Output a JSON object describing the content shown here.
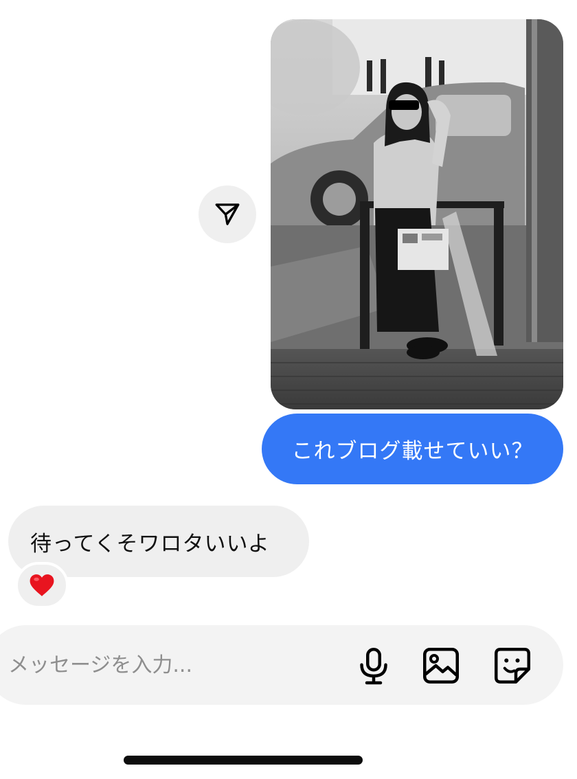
{
  "thread": {
    "outgoing_message": "これブログ載せていい？",
    "incoming_message": "待ってくそワロタいいよ",
    "reaction": "heart-emoji"
  },
  "composer": {
    "placeholder": "メッセージを入力..."
  },
  "icons": {
    "share": "paper-plane-icon",
    "mic": "microphone-icon",
    "gallery": "image-icon",
    "sticker": "sticker-icon"
  },
  "colors": {
    "outgoing_bubble": "#3478f6",
    "incoming_bubble": "#efefef",
    "reaction_heart": "#e8141f"
  }
}
